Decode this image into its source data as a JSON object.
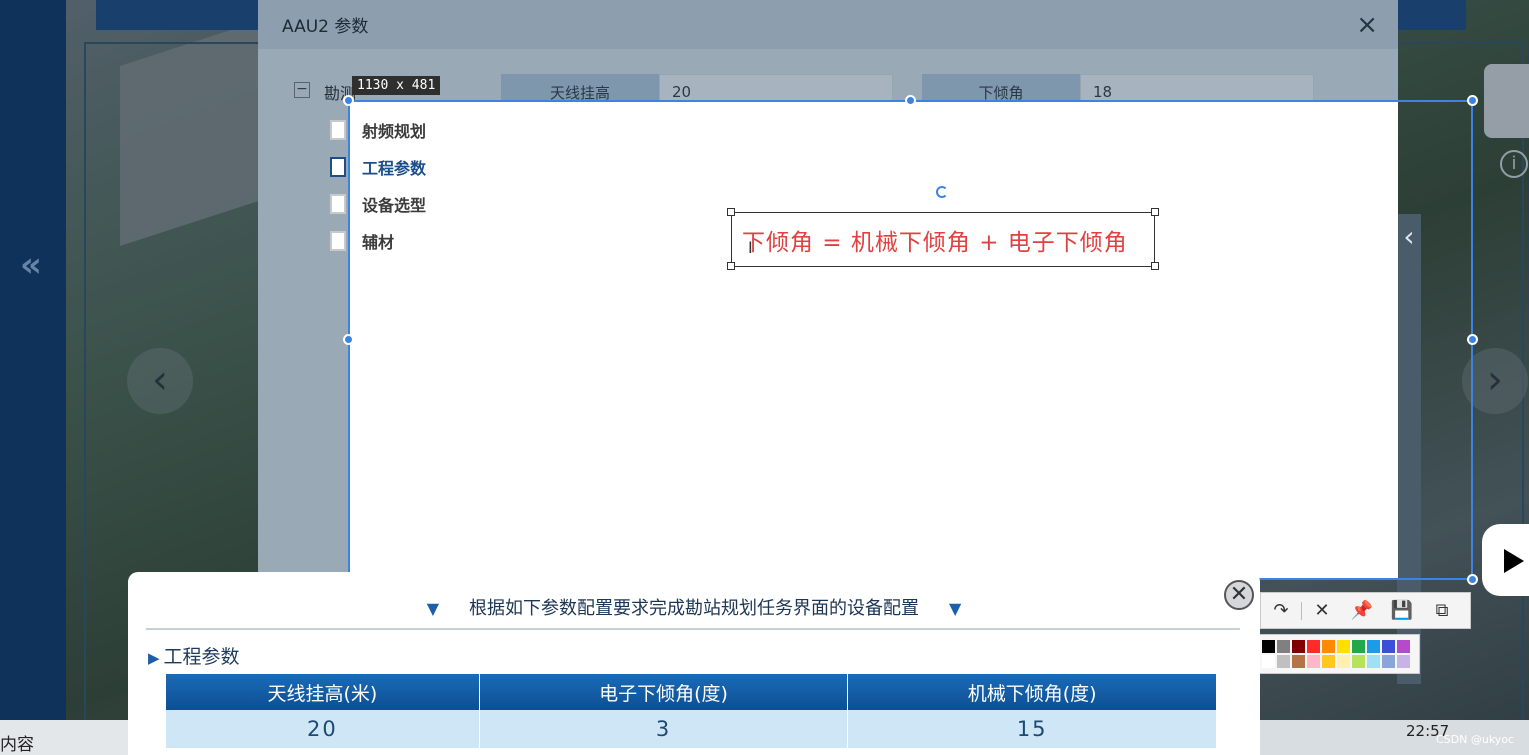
{
  "dialog": {
    "title": "AAU2 参数",
    "close_glyph": "×",
    "tree_root": "勘测",
    "tree_toggle": "−",
    "params": [
      {
        "label": "天线挂高",
        "value": "20"
      },
      {
        "label": "下倾角",
        "value": "18"
      }
    ]
  },
  "capture": {
    "size_label": "1130 x 481",
    "text_annotation": "下倾角 = 机械下倾角 + 电子下倾角",
    "text_color": "#e04141",
    "selection_color": "#3d83e4"
  },
  "sidebar": {
    "items": [
      {
        "label": "射频规划",
        "active": false
      },
      {
        "label": "工程参数",
        "active": true
      },
      {
        "label": "设备选型",
        "active": false
      },
      {
        "label": "辅材",
        "active": false
      }
    ]
  },
  "toolbar": {
    "icons": [
      "redo-icon",
      "close-icon",
      "pin-icon",
      "save-icon",
      "copy-icon"
    ],
    "glyphs": [
      "↷",
      "✕",
      "📌",
      "💾",
      "⧉"
    ],
    "palette": [
      "#000000",
      "#808080",
      "#800000",
      "#ff2b2b",
      "#ff8a00",
      "#ffe000",
      "#22a84a",
      "#1e9be8",
      "#3b4fd8",
      "#b44bc9",
      "#ffffff",
      "#c0c0c0",
      "#b5734a",
      "#ffb6c8",
      "#ffc81e",
      "#fff0b0",
      "#b6e35a",
      "#9fe0f7",
      "#8aa6d9",
      "#c7b4e6"
    ]
  },
  "task": {
    "title": "根据如下参数配置要求完成勘站规划任务界面的设备配置",
    "title_marker": "▼",
    "close_glyph": "✕",
    "section_marker": "▶",
    "section": "工程参数",
    "columns": [
      "天线挂高(米)",
      "电子下倾角(度)",
      "机械下倾角(度)"
    ],
    "rows": [
      [
        "20",
        "3",
        "15"
      ]
    ]
  },
  "background": {
    "collapse_glyph": "«",
    "prev_glyph": "‹",
    "next_glyph": "›",
    "info_glyph": "i",
    "edge_chevron": "‹"
  },
  "footer": {
    "left_text": "内容",
    "clock": "22:57",
    "credit": "CSDN @ukyoc"
  }
}
